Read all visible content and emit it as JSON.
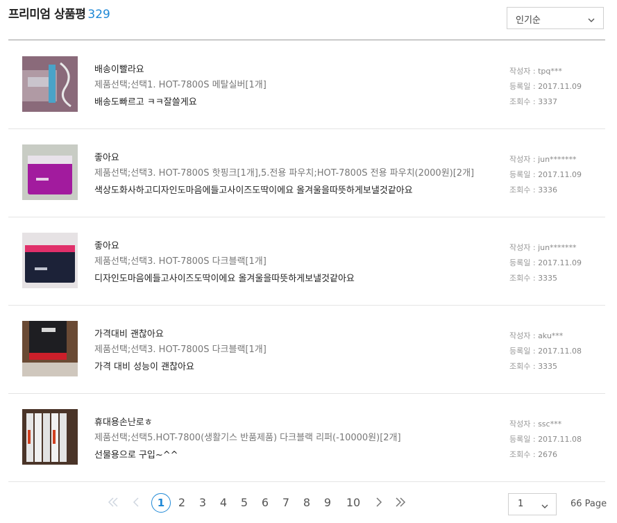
{
  "header": {
    "title": "프리미엄 상품평",
    "count": "329",
    "sort_value": "인기순"
  },
  "reviews": [
    {
      "title": "배송이빨라요",
      "option": "제품선택;선택1. HOT-7800S 메탈실버[1개]",
      "body": "배송도빠르고 ㅋㅋ잘쓸게요",
      "author_label": "작성자 : ",
      "author": "tpq***",
      "date_label": "등록일 : ",
      "date": "2017.11.09",
      "views_label": "조회수 : ",
      "views": "3337"
    },
    {
      "title": "좋아요",
      "option": "제품선택;선택3. HOT-7800S 핫핑크[1개],5.전용 파우치;HOT-7800S 전용 파우치(2000원)[2개]",
      "body": "색상도화사하고디자인도마음에들고사이즈도딱이에요 올겨울을따뜻하게보낼것같아요",
      "author_label": "작성자 : ",
      "author": "jun*******",
      "date_label": "등록일 : ",
      "date": "2017.11.09",
      "views_label": "조회수 : ",
      "views": "3336"
    },
    {
      "title": "좋아요",
      "option": "제품선택;선택3. HOT-7800S 다크블랙[1개]",
      "body": "디자인도마음에들고사이즈도딱이에요 올겨울을따뜻하게보낼것같아요",
      "author_label": "작성자 : ",
      "author": "jun*******",
      "date_label": "등록일 : ",
      "date": "2017.11.09",
      "views_label": "조회수 : ",
      "views": "3335"
    },
    {
      "title": "가격대비 괜찮아요",
      "option": "제품선택;선택3. HOT-7800S 다크블랙[1개]",
      "body": "가격 대비 성능이 괜찮아요",
      "author_label": "작성자 : ",
      "author": "aku***",
      "date_label": "등록일 : ",
      "date": "2017.11.08",
      "views_label": "조회수 : ",
      "views": "3335"
    },
    {
      "title": "휴대용손난로ㅎ",
      "option": "제품선택;선택5.HOT-7800(생활기스 반품제품) 다크블랙 리퍼(-10000원)[2개]",
      "body": "선물용으로 구입~^^",
      "author_label": "작성자 : ",
      "author": "ssc***",
      "date_label": "등록일 : ",
      "date": "2017.11.08",
      "views_label": "조회수 : ",
      "views": "2676"
    }
  ],
  "pager": {
    "pages": [
      "1",
      "2",
      "3",
      "4",
      "5",
      "6",
      "7",
      "8",
      "9",
      "10"
    ],
    "current": "1",
    "select_value": "1",
    "total": "66 Page"
  },
  "icons": {
    "first": "double-chevron-left-icon",
    "prev": "chevron-left-icon",
    "next": "chevron-right-icon",
    "last": "double-chevron-right-icon",
    "dropdown": "chevron-down-icon"
  },
  "colors": {
    "accent": "#1e88d6"
  }
}
